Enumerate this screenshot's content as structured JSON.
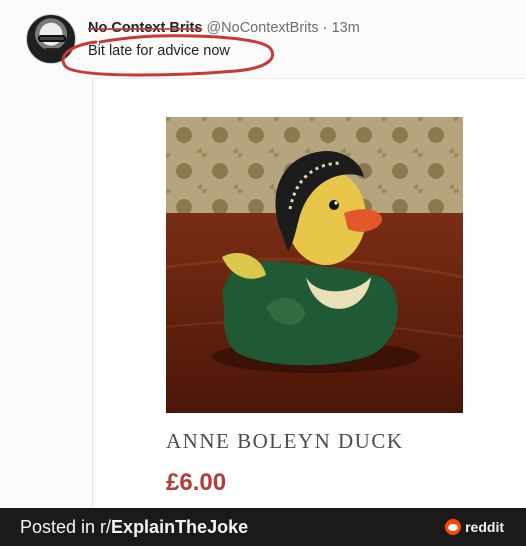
{
  "tweet": {
    "display_name": "No Context Brits",
    "handle": "@NoContextBrits",
    "separator": "·",
    "time": "13m",
    "text": "Bit late for advice now"
  },
  "product": {
    "name": "ANNE BOLEYN DUCK",
    "price": "£6.00"
  },
  "footer": {
    "posted_in": "Posted in r/",
    "subreddit": "ExplainTheJoke",
    "brand": "reddit"
  },
  "colors": {
    "price": "#b43c3c",
    "annotation": "#c73a3a",
    "footer_bg": "#1a1a1a",
    "reddit_orange": "#ff4500"
  }
}
